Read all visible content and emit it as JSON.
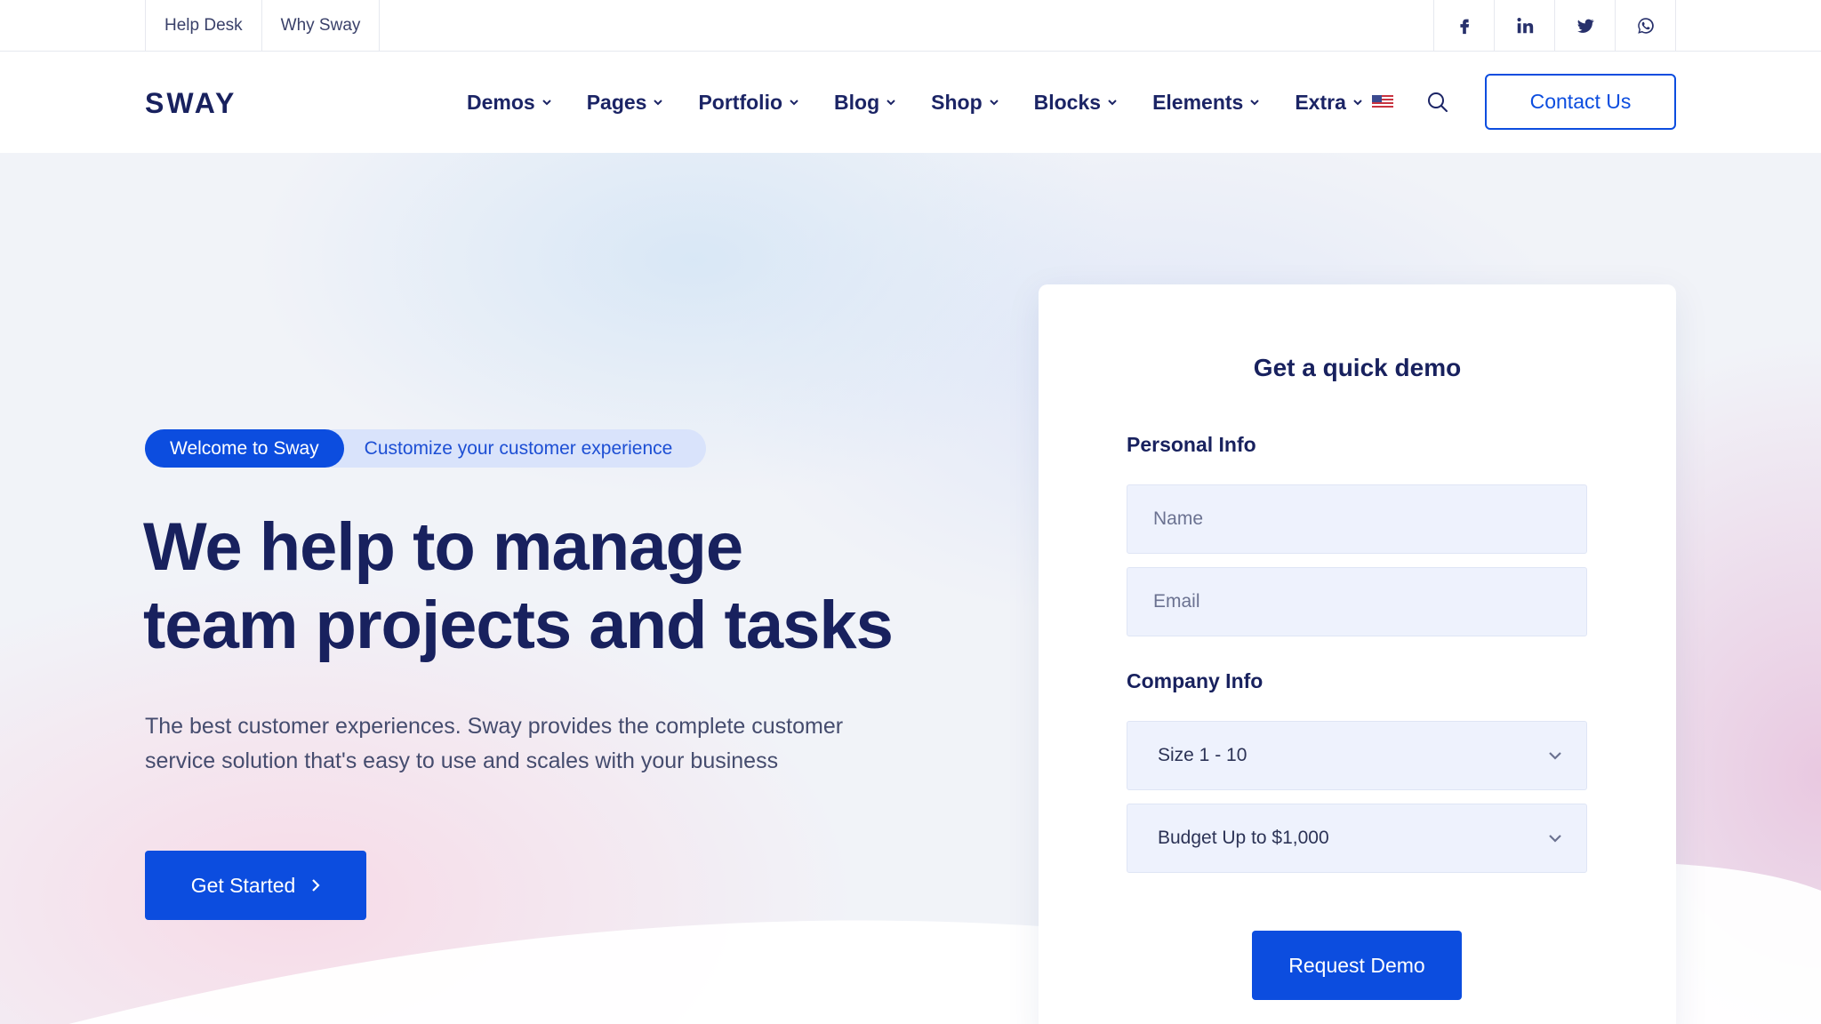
{
  "topbar": {
    "links": [
      "Help Desk",
      "Why Sway"
    ],
    "social": [
      "facebook-icon",
      "linkedin-icon",
      "twitter-icon",
      "whatsapp-icon"
    ]
  },
  "header": {
    "logo": "SWAY",
    "nav": [
      "Demos",
      "Pages",
      "Portfolio",
      "Blog",
      "Shop",
      "Blocks",
      "Elements",
      "Extra"
    ],
    "contact_label": "Contact Us"
  },
  "hero": {
    "badge": "Welcome to Sway",
    "badge_text": "Customize your customer experience",
    "title_line1": "We help to manage",
    "title_line2": "team projects and tasks",
    "description": "The best customer experiences. Sway provides the complete customer service solution that's easy to use and scales with your business",
    "cta_label": "Get Started"
  },
  "demo_form": {
    "title": "Get a quick demo",
    "personal_label": "Personal Info",
    "name_placeholder": "Name",
    "email_placeholder": "Email",
    "company_label": "Company Info",
    "size_value": "Size 1 - 10",
    "budget_value": "Budget Up to $1,000",
    "submit_label": "Request Demo"
  },
  "colors": {
    "accent": "#0c4ddf",
    "heading": "#18215e",
    "pill_bg": "#d9e3fb"
  }
}
